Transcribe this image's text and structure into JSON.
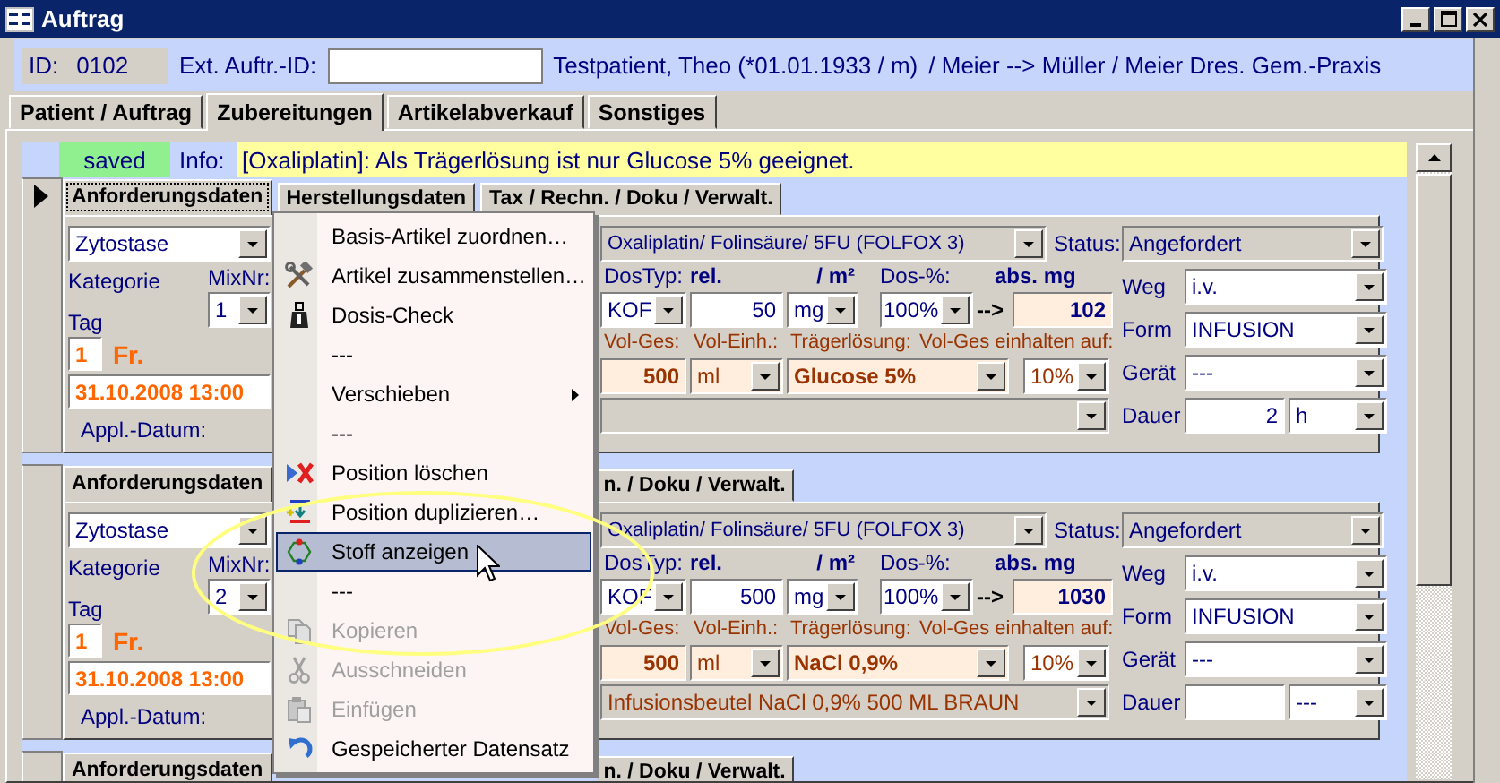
{
  "window": {
    "title": "Auftrag"
  },
  "header": {
    "id_label": "ID:",
    "id_value": "0102",
    "ext_id_label": "Ext. Auftr.-ID:",
    "patient": "Testpatient, Theo  (*01.01.1933 / m)",
    "referral": "/  Meier --> Müller / Meier Dres. Gem.-Praxis"
  },
  "tabs": [
    {
      "label": "Patient / Auftrag",
      "selected": false
    },
    {
      "label": "Zubereitungen",
      "selected": true
    },
    {
      "label": "Artikelabverkauf",
      "selected": false
    },
    {
      "label": "Sonstiges",
      "selected": false
    }
  ],
  "info_bar": {
    "status": "saved",
    "label": "Info:",
    "message": "[Oxaliplatin]: Als Trägerlösung ist nur Glucose 5% geeignet."
  },
  "records": [
    {
      "current": true,
      "tabs": [
        {
          "label": "Anforderungsdaten",
          "selected": true,
          "kind": "full"
        },
        {
          "label": "Herstellungsdaten",
          "selected": false,
          "kind": "full"
        },
        {
          "label": "Tax / Rechn. / Doku / Verwalt.",
          "selected": false,
          "kind": "full"
        }
      ],
      "category": "Zytostase",
      "category_label": "Kategorie",
      "mix_label": "MixNr:",
      "mix": "1",
      "day_label": "Tag",
      "day": "1",
      "weekday": "Fr.",
      "datetime": "31.10.2008  13:00",
      "appl_label": "Appl.-Datum:",
      "product": "Oxaliplatin/ Folinsäure/ 5FU   (FOLFOX 3)",
      "status_label": "Status:",
      "status": "Angefordert",
      "dostyp_label": "DosTyp:",
      "rel_label": "rel.",
      "per_m2_label": "/ m²",
      "dos_pct_label": "Dos-%:",
      "abs_label": "abs. mg",
      "dostyp": "KOF",
      "rel": "50",
      "unit": "mg",
      "dos_pct": "100%",
      "arrow": "-->",
      "abs": "102",
      "vol_label": "Vol-Ges:",
      "vol_unit_label": "Vol-Einh.:",
      "carrier_label": "Trägerlösung:",
      "keep_label": "Vol-Ges einhalten auf:",
      "vol": "500",
      "vol_unit": "ml",
      "carrier": "Glucose 5%",
      "keep": "10%",
      "route_label": "Weg",
      "route": "i.v.",
      "form_label": "Form",
      "form": "INFUSION",
      "device_label": "Gerät",
      "device": "---",
      "duration_label": "Dauer",
      "duration": "2",
      "duration_unit": "h"
    },
    {
      "current": false,
      "tabs": [
        {
          "label": "Anforderungsdaten",
          "selected": true,
          "kind": "full"
        },
        {
          "label": "n. / Doku / Verwalt.",
          "selected": false,
          "kind": "cut"
        }
      ],
      "category": "Zytostase",
      "category_label": "Kategorie",
      "mix_label": "MixNr:",
      "mix": "2",
      "day_label": "Tag",
      "day": "1",
      "weekday": "Fr.",
      "datetime": "31.10.2008  13:00",
      "appl_label": "Appl.-Datum:",
      "product": "Oxaliplatin/ Folinsäure/ 5FU   (FOLFOX 3)",
      "status_label": "Status:",
      "status": "Angefordert",
      "dostyp_label": "DosTyp:",
      "rel_label": "rel.",
      "per_m2_label": "/ m²",
      "dos_pct_label": "Dos-%:",
      "abs_label": "abs. mg",
      "dostyp": "KOF",
      "rel": "500",
      "unit": "mg",
      "dos_pct": "100%",
      "arrow": "-->",
      "abs": "1030",
      "vol_label": "Vol-Ges:",
      "vol_unit_label": "Vol-Einh.:",
      "carrier_label": "Trägerlösung:",
      "keep_label": "Vol-Ges einhalten auf:",
      "vol": "500",
      "vol_unit": "ml",
      "carrier": "NaCl 0,9%",
      "keep": "10%",
      "package": "Infusionsbeutel NaCl 0,9% 500 ML BRAUN",
      "route_label": "Weg",
      "route": "i.v.",
      "form_label": "Form",
      "form": "INFUSION",
      "device_label": "Gerät",
      "device": "---",
      "duration_label": "Dauer",
      "duration_unit": "---"
    },
    {
      "current": false,
      "tabs": [
        {
          "label": "Anforderungsdaten",
          "selected": true,
          "kind": "full"
        },
        {
          "label": "n. / Doku / Verwalt.",
          "selected": false,
          "kind": "cut"
        }
      ]
    }
  ],
  "context_menu": {
    "items": [
      {
        "label": "Basis-Artikel zuordnen…",
        "kind": "command",
        "selected": false,
        "disabled": false
      },
      {
        "label": "Artikel zusammenstellen…",
        "kind": "command",
        "selected": false,
        "disabled": false
      },
      {
        "label": "Dosis-Check",
        "kind": "command",
        "selected": false,
        "disabled": false
      },
      {
        "label": "---",
        "kind": "command",
        "selected": false,
        "disabled": false
      },
      {
        "label": "Verschieben",
        "kind": "submenu",
        "selected": false,
        "disabled": false
      },
      {
        "label": "---",
        "kind": "command",
        "selected": false,
        "disabled": false
      },
      {
        "label": "Position löschen",
        "kind": "command",
        "selected": false,
        "disabled": false
      },
      {
        "label": "Position duplizieren…",
        "kind": "command",
        "selected": false,
        "disabled": false
      },
      {
        "label": "Stoff anzeigen",
        "kind": "command",
        "selected": true,
        "disabled": false
      },
      {
        "label": "---",
        "kind": "command",
        "selected": false,
        "disabled": false
      },
      {
        "label": "Kopieren",
        "kind": "command",
        "selected": false,
        "disabled": true
      },
      {
        "label": "Ausschneiden",
        "kind": "command",
        "selected": false,
        "disabled": true
      },
      {
        "label": "Einfügen",
        "kind": "command",
        "selected": false,
        "disabled": true
      },
      {
        "label": "Gespeicherter Datensatz",
        "kind": "command",
        "selected": false,
        "disabled": false
      }
    ]
  }
}
